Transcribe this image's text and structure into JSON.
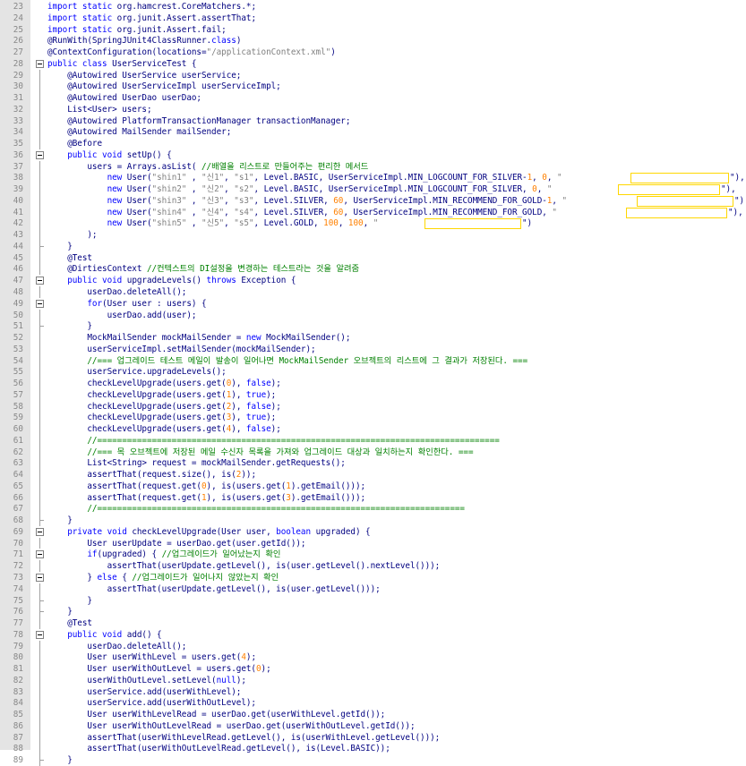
{
  "editor": {
    "lines": [
      {
        "num": "23",
        "t": [
          [
            "k",
            "import static "
          ],
          [
            "a",
            "org.hamcrest.CoreMatchers.*;"
          ]
        ]
      },
      {
        "num": "24",
        "t": [
          [
            "k",
            "import static "
          ],
          [
            "a",
            "org.junit.Assert.assertThat;"
          ]
        ]
      },
      {
        "num": "25",
        "t": [
          [
            "k",
            "import static "
          ],
          [
            "a",
            "org.junit.Assert.fail;"
          ]
        ]
      },
      {
        "num": "26",
        "t": [
          [
            "a",
            "@RunWith(SpringJUnit4ClassRunner."
          ],
          [
            "k",
            "class"
          ],
          [
            "a",
            ")"
          ]
        ]
      },
      {
        "num": "27",
        "t": [
          [
            "a",
            "@ContextConfiguration(locations="
          ],
          [
            "s",
            "\"/applicationContext.xml\""
          ],
          [
            "a",
            ")"
          ]
        ]
      },
      {
        "num": "28",
        "t": [
          [
            "k",
            "public class "
          ],
          [
            "a",
            "UserServiceTest {"
          ]
        ]
      },
      {
        "num": "29",
        "t": [
          [
            "a",
            "    @Autowired UserService userService;"
          ]
        ]
      },
      {
        "num": "30",
        "t": [
          [
            "a",
            "    @Autowired UserServiceImpl userServiceImpl;"
          ]
        ]
      },
      {
        "num": "31",
        "t": [
          [
            "a",
            "    @Autowired UserDao userDao;"
          ]
        ]
      },
      {
        "num": "32",
        "t": [
          [
            "a",
            "    List<User> users;"
          ]
        ]
      },
      {
        "num": "33",
        "t": [
          [
            "a",
            "    @Autowired PlatformTransactionManager transactionManager;"
          ]
        ]
      },
      {
        "num": "34",
        "t": [
          [
            "a",
            "    @Autowired MailSender mailSender;"
          ]
        ]
      },
      {
        "num": "35",
        "t": [
          [
            "a",
            "    @Before"
          ]
        ]
      },
      {
        "num": "36",
        "t": [
          [
            "k",
            "    public void "
          ],
          [
            "a",
            "setUp() {"
          ]
        ]
      },
      {
        "num": "37",
        "t": [
          [
            "a",
            "        users = Arrays.asList( "
          ],
          [
            "c",
            "//배열을 리스트로 만들어주는 편리한 메서드"
          ]
        ]
      },
      {
        "num": "38",
        "t": [
          [
            "k",
            "            new "
          ],
          [
            "a",
            "User("
          ],
          [
            "s",
            "\"shin1\""
          ],
          [
            "a",
            " , "
          ],
          [
            "s",
            "\"신1\""
          ],
          [
            "a",
            ", "
          ],
          [
            "s",
            "\"s1\""
          ],
          [
            "a",
            ", Level.BASIC, UserServiceImpl.MIN_LOGCOUNT_FOR_SILVER-"
          ],
          [
            "n",
            "1"
          ],
          [
            "a",
            ", "
          ],
          [
            "n",
            "0"
          ],
          [
            "a",
            ", "
          ],
          [
            "s",
            "\""
          ]
        ]
      },
      {
        "num": "39",
        "t": [
          [
            "k",
            "            new "
          ],
          [
            "a",
            "User("
          ],
          [
            "s",
            "\"shin2\""
          ],
          [
            "a",
            " , "
          ],
          [
            "s",
            "\"신2\""
          ],
          [
            "a",
            ", "
          ],
          [
            "s",
            "\"s2\""
          ],
          [
            "a",
            ", Level.BASIC, UserServiceImpl.MIN_LOGCOUNT_FOR_SILVER, "
          ],
          [
            "n",
            "0"
          ],
          [
            "a",
            ", "
          ],
          [
            "s",
            "\""
          ]
        ]
      },
      {
        "num": "40",
        "t": [
          [
            "k",
            "            new "
          ],
          [
            "a",
            "User("
          ],
          [
            "s",
            "\"shin3\""
          ],
          [
            "a",
            " , "
          ],
          [
            "s",
            "\"신3\""
          ],
          [
            "a",
            ", "
          ],
          [
            "s",
            "\"s3\""
          ],
          [
            "a",
            ", Level.SILVER, "
          ],
          [
            "n",
            "60"
          ],
          [
            "a",
            ", UserServiceImpl.MIN_RECOMMEND_FOR_GOLD-"
          ],
          [
            "n",
            "1"
          ],
          [
            "a",
            ", "
          ],
          [
            "s",
            "\""
          ]
        ]
      },
      {
        "num": "41",
        "t": [
          [
            "k",
            "            new "
          ],
          [
            "a",
            "User("
          ],
          [
            "s",
            "\"shin4\""
          ],
          [
            "a",
            " , "
          ],
          [
            "s",
            "\"신4\""
          ],
          [
            "a",
            ", "
          ],
          [
            "s",
            "\"s4\""
          ],
          [
            "a",
            ", Level.SILVER, "
          ],
          [
            "n",
            "60"
          ],
          [
            "a",
            ", UserServiceImpl.MIN_RECOMMEND_FOR_GOLD, "
          ],
          [
            "s",
            "\""
          ]
        ]
      },
      {
        "num": "42",
        "t": [
          [
            "k",
            "            new "
          ],
          [
            "a",
            "User("
          ],
          [
            "s",
            "\"shin5\""
          ],
          [
            "a",
            " , "
          ],
          [
            "s",
            "\"신5\""
          ],
          [
            "a",
            ", "
          ],
          [
            "s",
            "\"s5\""
          ],
          [
            "a",
            ", Level.GOLD, "
          ],
          [
            "n",
            "100"
          ],
          [
            "a",
            ", "
          ],
          [
            "n",
            "100"
          ],
          [
            "a",
            ", "
          ],
          [
            "s",
            "\""
          ]
        ]
      },
      {
        "num": "43",
        "t": [
          [
            "a",
            "        );"
          ]
        ]
      },
      {
        "num": "44",
        "t": [
          [
            "a",
            "    }"
          ]
        ]
      },
      {
        "num": "45",
        "t": [
          [
            "a",
            "    @Test"
          ]
        ]
      },
      {
        "num": "46",
        "t": [
          [
            "a",
            "    @DirtiesContext "
          ],
          [
            "c",
            "//컨텍스트의 DI설정을 변경하는 테스트라는 것을 알려줌"
          ]
        ]
      },
      {
        "num": "47",
        "t": [
          [
            "k",
            "    public void "
          ],
          [
            "a",
            "upgradeLevels() "
          ],
          [
            "k",
            "throws "
          ],
          [
            "a",
            "Exception {"
          ]
        ]
      },
      {
        "num": "48",
        "t": [
          [
            "a",
            "        userDao.deleteAll();"
          ]
        ]
      },
      {
        "num": "49",
        "t": [
          [
            "k",
            "        for"
          ],
          [
            "a",
            "(User user : users) {"
          ]
        ]
      },
      {
        "num": "50",
        "t": [
          [
            "a",
            "            userDao.add(user);"
          ]
        ]
      },
      {
        "num": "51",
        "t": [
          [
            "a",
            "        }"
          ]
        ]
      },
      {
        "num": "52",
        "t": [
          [
            "a",
            "        MockMailSender mockMailSender = "
          ],
          [
            "k",
            "new "
          ],
          [
            "a",
            "MockMailSender();"
          ]
        ]
      },
      {
        "num": "53",
        "t": [
          [
            "a",
            "        userServiceImpl.setMailSender(mockMailSender);"
          ]
        ]
      },
      {
        "num": "54",
        "t": [
          [
            "c",
            "        //=== 업그레이드 테스트 메일이 발송이 일어나면 MockMailSender 오브젝트의 리스트에 그 결과가 저장된다. ==="
          ]
        ]
      },
      {
        "num": "55",
        "t": [
          [
            "a",
            "        userService.upgradeLevels();"
          ]
        ]
      },
      {
        "num": "56",
        "t": [
          [
            "a",
            "        checkLevelUpgrade(users.get("
          ],
          [
            "n",
            "0"
          ],
          [
            "a",
            "), "
          ],
          [
            "k",
            "false"
          ],
          [
            "a",
            ");"
          ]
        ]
      },
      {
        "num": "57",
        "t": [
          [
            "a",
            "        checkLevelUpgrade(users.get("
          ],
          [
            "n",
            "1"
          ],
          [
            "a",
            "), "
          ],
          [
            "k",
            "true"
          ],
          [
            "a",
            ");"
          ]
        ]
      },
      {
        "num": "58",
        "t": [
          [
            "a",
            "        checkLevelUpgrade(users.get("
          ],
          [
            "n",
            "2"
          ],
          [
            "a",
            "), "
          ],
          [
            "k",
            "false"
          ],
          [
            "a",
            ");"
          ]
        ]
      },
      {
        "num": "59",
        "t": [
          [
            "a",
            "        checkLevelUpgrade(users.get("
          ],
          [
            "n",
            "3"
          ],
          [
            "a",
            "), "
          ],
          [
            "k",
            "true"
          ],
          [
            "a",
            ");"
          ]
        ]
      },
      {
        "num": "60",
        "t": [
          [
            "a",
            "        checkLevelUpgrade(users.get("
          ],
          [
            "n",
            "4"
          ],
          [
            "a",
            "), "
          ],
          [
            "k",
            "false"
          ],
          [
            "a",
            ");"
          ]
        ]
      },
      {
        "num": "61",
        "t": [
          [
            "c",
            "        //================================================================================="
          ]
        ]
      },
      {
        "num": "62",
        "t": [
          [
            "c",
            "        //=== 목 오브젝트에 저장된 메일 수신자 목록을 가져와 업그레이드 대상과 일치하는지 확인한다. ==="
          ]
        ]
      },
      {
        "num": "63",
        "t": [
          [
            "a",
            "        List<String> request = mockMailSender.getRequests();"
          ]
        ]
      },
      {
        "num": "64",
        "t": [
          [
            "a",
            "        assertThat(request.size(), is("
          ],
          [
            "n",
            "2"
          ],
          [
            "a",
            "));"
          ]
        ]
      },
      {
        "num": "65",
        "t": [
          [
            "a",
            "        assertThat(request.get("
          ],
          [
            "n",
            "0"
          ],
          [
            "a",
            "), is(users.get("
          ],
          [
            "n",
            "1"
          ],
          [
            "a",
            ").getEmail()));"
          ]
        ]
      },
      {
        "num": "66",
        "t": [
          [
            "a",
            "        assertThat(request.get("
          ],
          [
            "n",
            "1"
          ],
          [
            "a",
            "), is(users.get("
          ],
          [
            "n",
            "3"
          ],
          [
            "a",
            ").getEmail()));"
          ]
        ]
      },
      {
        "num": "67",
        "t": [
          [
            "c",
            "        //=========================================================================="
          ]
        ]
      },
      {
        "num": "68",
        "t": [
          [
            "a",
            "    }"
          ]
        ]
      },
      {
        "num": "69",
        "t": [
          [
            "k",
            "    private void "
          ],
          [
            "a",
            "checkLevelUpgrade(User user, "
          ],
          [
            "k",
            "boolean "
          ],
          [
            "a",
            "upgraded) {"
          ]
        ]
      },
      {
        "num": "70",
        "t": [
          [
            "a",
            "        User userUpdate = userDao.get(user.getId());"
          ]
        ]
      },
      {
        "num": "71",
        "t": [
          [
            "k",
            "        if"
          ],
          [
            "a",
            "(upgraded) { "
          ],
          [
            "c",
            "//업그레이드가 일어났는지 확인"
          ]
        ]
      },
      {
        "num": "72",
        "t": [
          [
            "a",
            "            assertThat(userUpdate.getLevel(), is(user.getLevel().nextLevel()));"
          ]
        ]
      },
      {
        "num": "73",
        "t": [
          [
            "a",
            "        } "
          ],
          [
            "k",
            "else "
          ],
          [
            "a",
            "{ "
          ],
          [
            "c",
            "//업그레이드가 일어나지 않았는지 확인"
          ]
        ]
      },
      {
        "num": "74",
        "t": [
          [
            "a",
            "            assertThat(userUpdate.getLevel(), is(user.getLevel()));"
          ]
        ]
      },
      {
        "num": "75",
        "t": [
          [
            "a",
            "        }"
          ]
        ]
      },
      {
        "num": "76",
        "t": [
          [
            "a",
            "    }"
          ]
        ]
      },
      {
        "num": "77",
        "t": [
          [
            "a",
            "    @Test"
          ]
        ]
      },
      {
        "num": "78",
        "t": [
          [
            "k",
            "    public void "
          ],
          [
            "a",
            "add() {"
          ]
        ]
      },
      {
        "num": "79",
        "t": [
          [
            "a",
            "        userDao.deleteAll();"
          ]
        ]
      },
      {
        "num": "80",
        "t": [
          [
            "a",
            "        User userWithLevel = users.get("
          ],
          [
            "n",
            "4"
          ],
          [
            "a",
            ");"
          ]
        ]
      },
      {
        "num": "81",
        "t": [
          [
            "a",
            "        User userWithOutLevel = users.get("
          ],
          [
            "n",
            "0"
          ],
          [
            "a",
            ");"
          ]
        ]
      },
      {
        "num": "82",
        "t": [
          [
            "a",
            "        userWithOutLevel.setLevel("
          ],
          [
            "k",
            "null"
          ],
          [
            "a",
            ");"
          ]
        ]
      },
      {
        "num": "83",
        "t": [
          [
            "a",
            "        userService.add(userWithLevel);"
          ]
        ]
      },
      {
        "num": "84",
        "t": [
          [
            "a",
            "        userService.add(userWithOutLevel);"
          ]
        ]
      },
      {
        "num": "85",
        "t": [
          [
            "a",
            "        User userWithLevelRead = userDao.get(userWithLevel.getId());"
          ]
        ]
      },
      {
        "num": "86",
        "t": [
          [
            "a",
            "        User userWithOutLevelRead = userDao.get(userWithOutLevel.getId());"
          ]
        ]
      },
      {
        "num": "87",
        "t": [
          [
            "a",
            "        assertThat(userWithLevelRead.getLevel(), is(userWithLevel.getLevel()));"
          ]
        ]
      },
      {
        "num": "88",
        "t": [
          [
            "a",
            "        assertThat(userWithOutLevelRead.getLevel(), is(Level.BASIC));"
          ]
        ]
      },
      {
        "num": "89",
        "t": [
          [
            "a",
            "    }"
          ]
        ]
      }
    ],
    "line_tails": {
      "38": "\"),",
      "39": "\"),",
      "40": "\")",
      "41": "\"),",
      "42": "\")"
    },
    "colors": {
      "keyword": "#0000ff",
      "string": "#808080",
      "number": "#ff8000",
      "comment": "#008000",
      "text": "#000080",
      "redaction_border": "#ffd700"
    }
  }
}
